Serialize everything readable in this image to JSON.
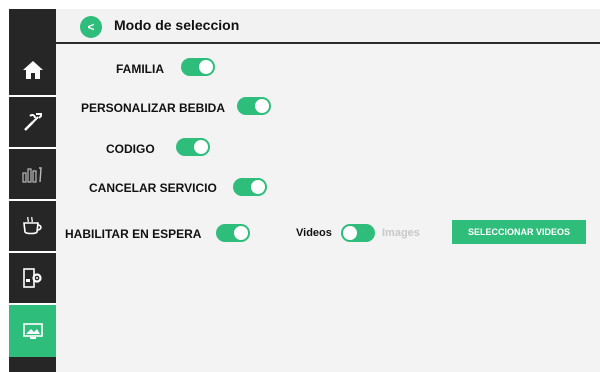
{
  "header": {
    "back_label": "<",
    "title": "Modo de seleccion"
  },
  "sidebar": {
    "items": [
      {
        "icon": "home-icon"
      },
      {
        "icon": "wrench-icon"
      },
      {
        "icon": "stats-icon"
      },
      {
        "icon": "coffee-cup-icon"
      },
      {
        "icon": "machine-settings-icon"
      },
      {
        "icon": "display-icon",
        "active": true
      }
    ]
  },
  "settings": {
    "familia": {
      "label": "FAMILIA",
      "on": true
    },
    "personalizar": {
      "label": "PERSONALIZAR BEBIDA",
      "on": true
    },
    "codigo": {
      "label": "CODIGO",
      "on": true
    },
    "cancelar": {
      "label": "CANCELAR SERVICIO",
      "on": true
    },
    "habilitar": {
      "label": "HABILITAR EN ESPERA",
      "on": true
    }
  },
  "media": {
    "videos_label": "Videos",
    "images_label": "Images",
    "mode": "videos",
    "select_button": "SELECCIONAR VIDEOS"
  },
  "colors": {
    "accent": "#2ebd7a",
    "sidebar": "#262626",
    "background": "#f3f3f3"
  }
}
